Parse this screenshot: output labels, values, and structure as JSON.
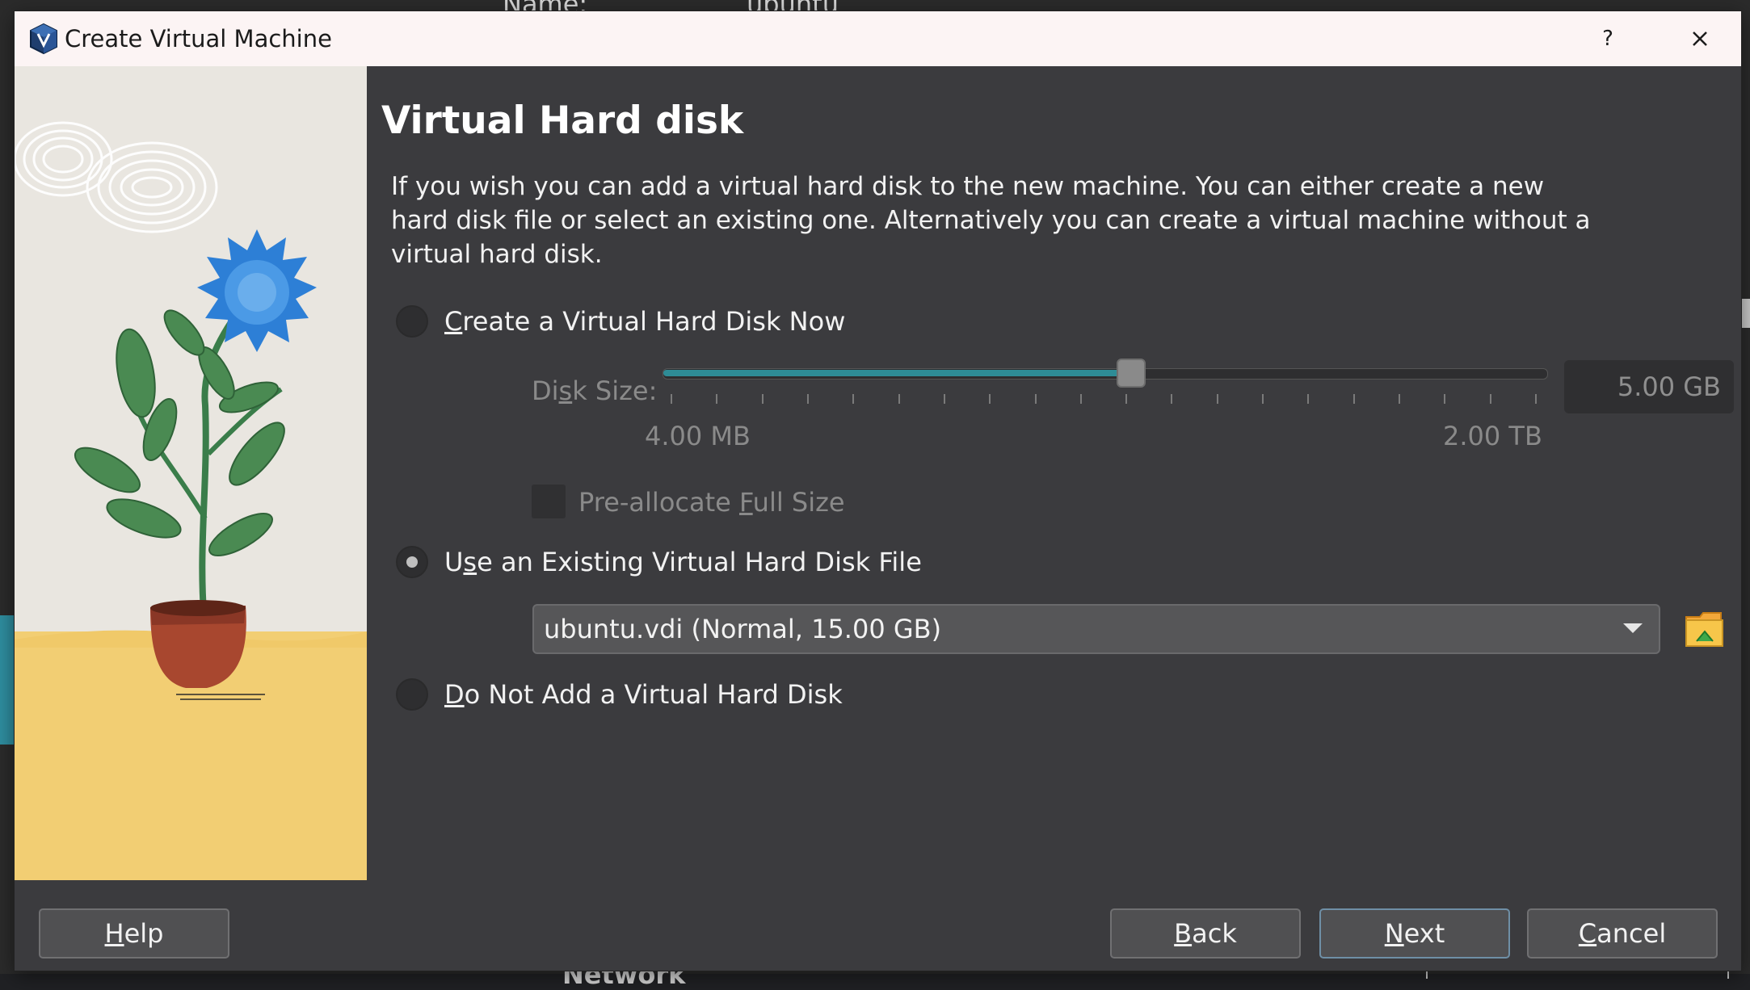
{
  "background": {
    "name_label": "Name:",
    "name_value": "ubuntu",
    "bottom_text": "Network"
  },
  "titlebar": {
    "title": "Create Virtual Machine",
    "help": "?",
    "close_icon": "close-icon",
    "app_icon": "virtualbox-icon"
  },
  "page": {
    "heading": "Virtual Hard disk",
    "description": "If you wish you can add a virtual hard disk to the new machine. You can either create a new hard disk file or select an existing one. Alternatively you can create a virtual machine without a virtual hard disk."
  },
  "options": {
    "create_now": {
      "prefix": "C",
      "rest": "reate a Virtual Hard Disk Now",
      "selected": false
    },
    "disk_size": {
      "label_pre": "Di",
      "label_u": "s",
      "label_post": "k Size:",
      "value": "5.00 GB",
      "min_label": "4.00 MB",
      "max_label": "2.00 TB",
      "slider_fraction": 0.53
    },
    "preallocate": {
      "label_pre": "Pre-allocate ",
      "label_u": "F",
      "label_post": "ull Size",
      "checked": false
    },
    "use_existing": {
      "pre": "U",
      "u": "s",
      "post": "e an Existing Virtual Hard Disk File",
      "selected": true,
      "selected_file": "ubuntu.vdi (Normal, 15.00 GB)",
      "folder_icon": "folder-open-icon"
    },
    "do_not_add": {
      "u": "D",
      "post": "o Not Add a Virtual Hard Disk",
      "selected": false
    }
  },
  "buttons": {
    "help": {
      "u": "H",
      "rest": "elp"
    },
    "back": {
      "u": "B",
      "rest": "ack"
    },
    "next": {
      "u": "N",
      "rest": "ext"
    },
    "cancel": {
      "u": "C",
      "rest": "ancel"
    }
  },
  "colors": {
    "accent": "#2e8c96",
    "dialog_bg": "#3b3b3e",
    "titlebar_bg": "#fcf4f4"
  }
}
